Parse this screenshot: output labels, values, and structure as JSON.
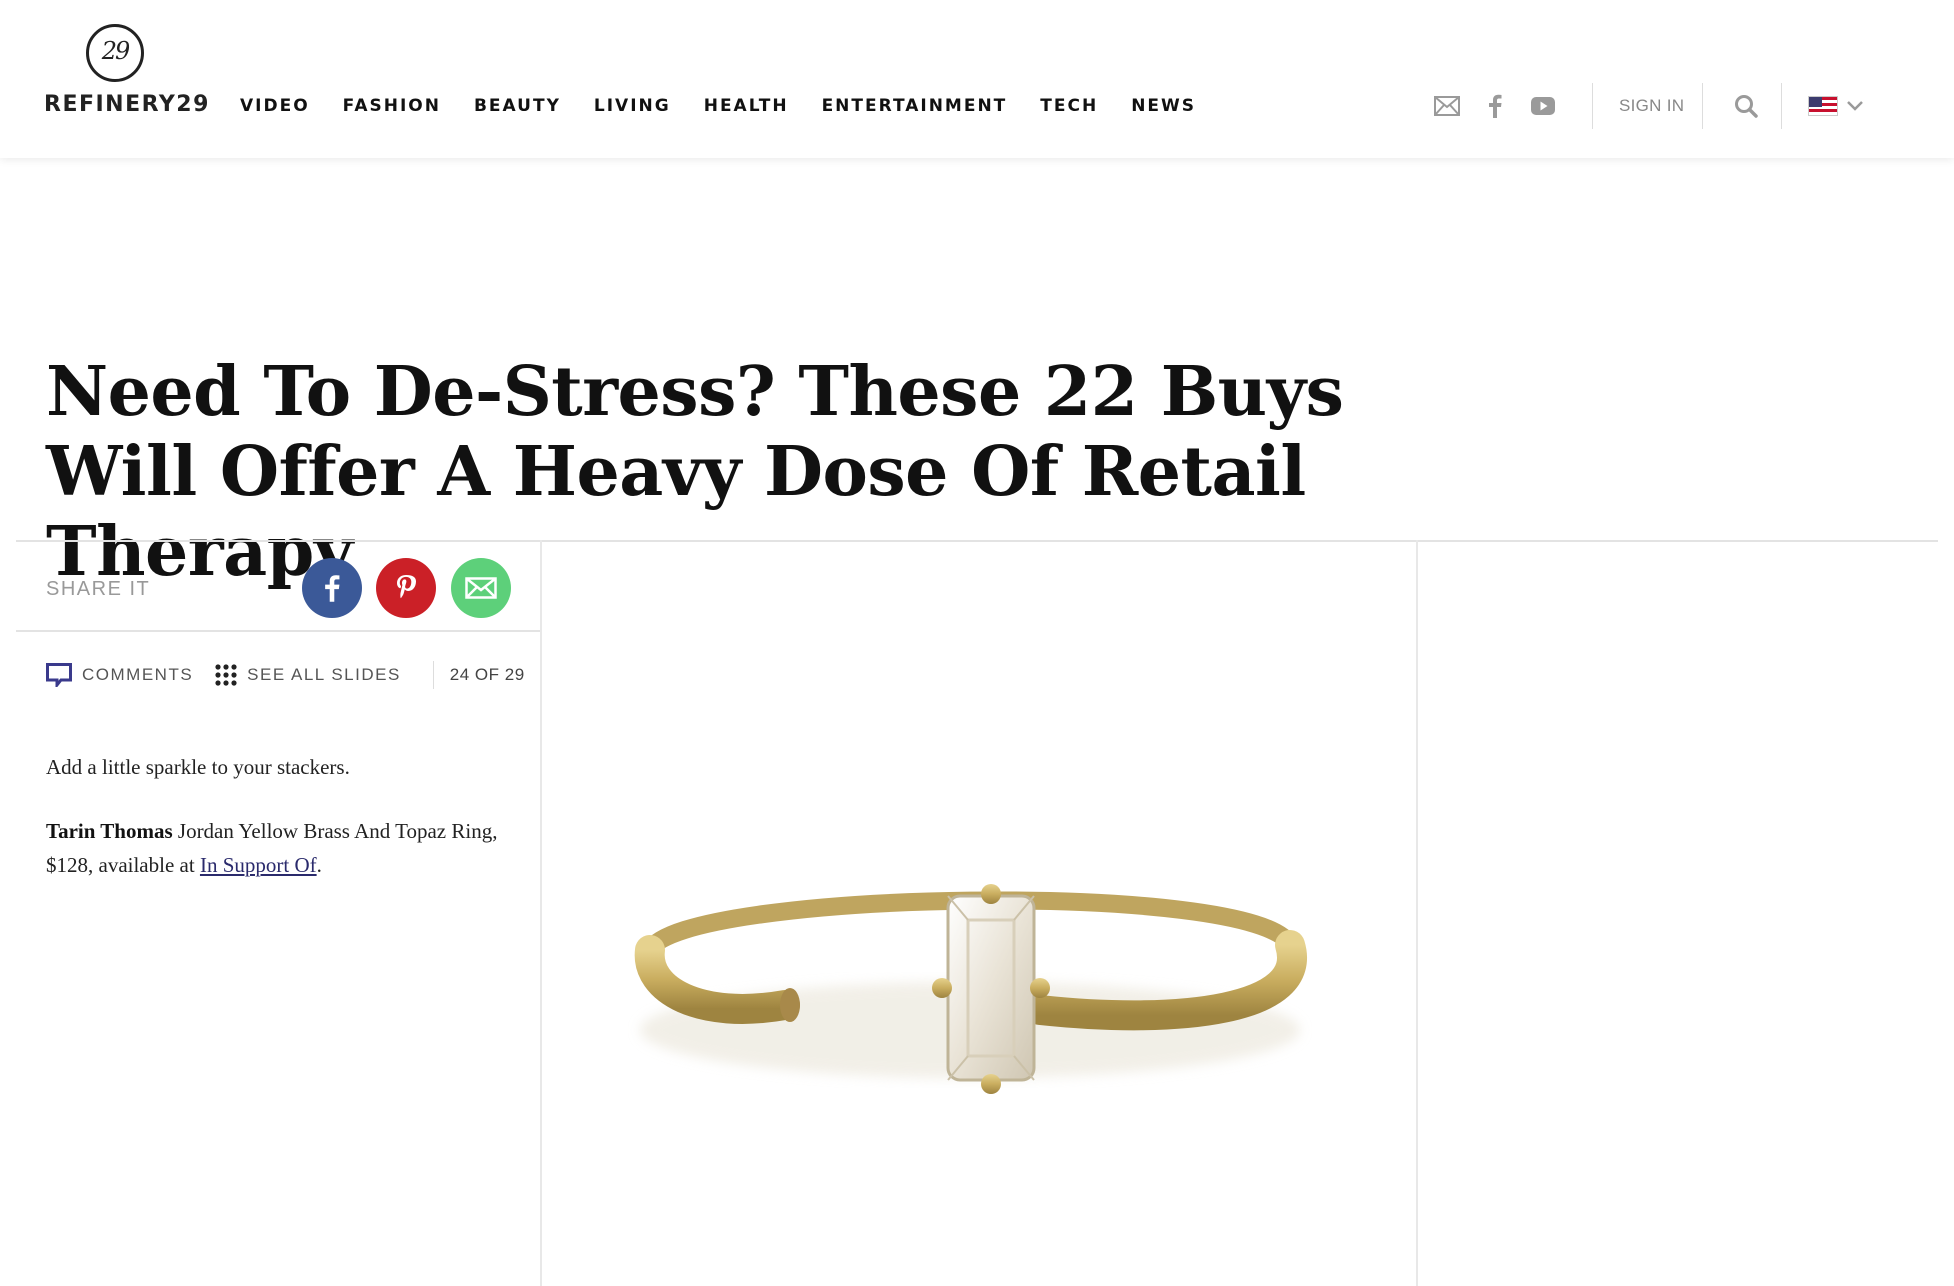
{
  "brand": {
    "logo_mark": "29",
    "name": "REFINERY29"
  },
  "nav": {
    "items": [
      "VIDEO",
      "FASHION",
      "BEAUTY",
      "LIVING",
      "HEALTH",
      "ENTERTAINMENT",
      "TECH",
      "NEWS"
    ]
  },
  "header_right": {
    "icons": [
      "mail-icon",
      "facebook-icon",
      "youtube-icon"
    ],
    "sign_in": "SIGN IN",
    "search_icon": "search-icon",
    "locale_flag": "us-flag-icon"
  },
  "article": {
    "title": "Need To De-Stress? These 22 Buys Will Offer A Heavy Dose Of Retail Therapy"
  },
  "share": {
    "label": "SHARE IT",
    "buttons": [
      {
        "icon": "facebook-icon",
        "color": "#3b5998"
      },
      {
        "icon": "pinterest-icon",
        "color": "#cb2027"
      },
      {
        "icon": "email-icon",
        "color": "#5dd07a"
      }
    ]
  },
  "tools": {
    "comments": "COMMENTS",
    "see_all": "SEE ALL SLIDES",
    "counter": "24 OF 29"
  },
  "slide": {
    "caption": "Add a little sparkle to your stackers.",
    "brand_bold": "Tarin Thomas",
    "product_text": " Jordan Yellow Brass And Topaz Ring, $128, available at ",
    "link_text": "In Support Of",
    "after_link": "."
  },
  "colors": {
    "accent_link": "#2a2a6c",
    "comments_icon": "#3a3a8c"
  }
}
